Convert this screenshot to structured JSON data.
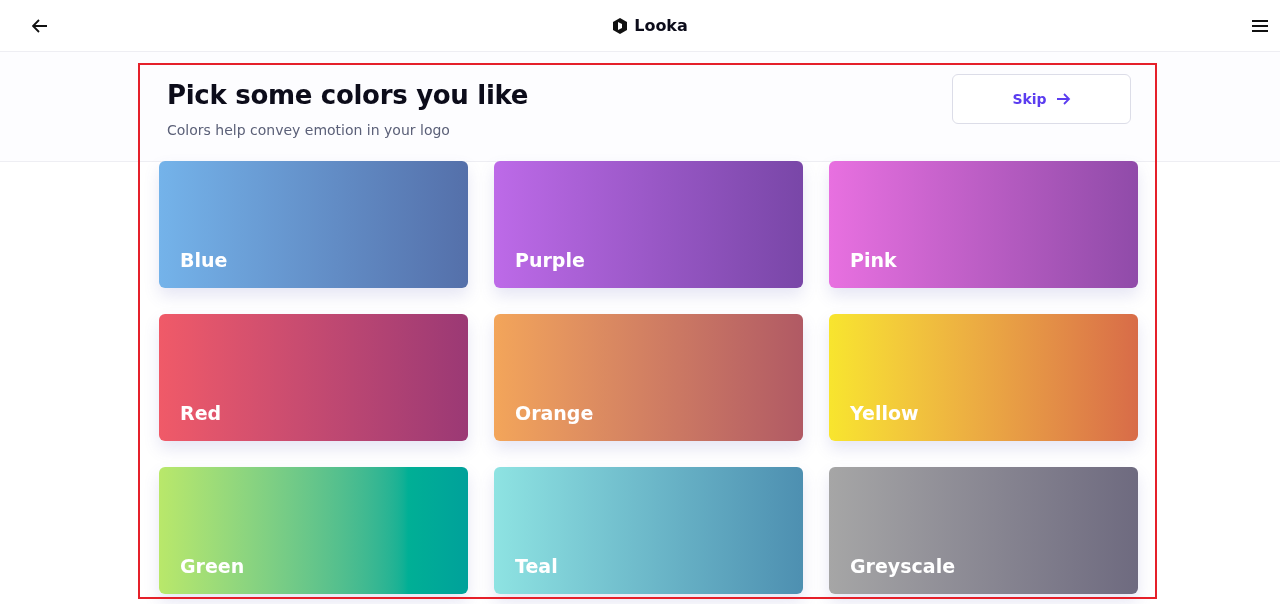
{
  "header": {
    "logo": "Looka"
  },
  "intro": {
    "title": "Pick some colors you like",
    "subtitle": "Colors help convey emotion in your logo",
    "skip": "Skip"
  },
  "swatches": [
    {
      "label": "Blue",
      "color": "#74b3ea"
    },
    {
      "label": "Purple",
      "color": "#bd6ae8"
    },
    {
      "label": "Pink",
      "color": "#e870e0"
    },
    {
      "label": "Red",
      "color": "#f05a68"
    },
    {
      "label": "Orange",
      "color": "#f3a55a"
    },
    {
      "label": "Yellow",
      "color": "#f8e52e"
    },
    {
      "label": "Green",
      "color": "#b9e86a"
    },
    {
      "label": "Teal",
      "color": "#8ee3e2"
    },
    {
      "label": "Greyscale",
      "color": "#a6a6a6"
    }
  ]
}
